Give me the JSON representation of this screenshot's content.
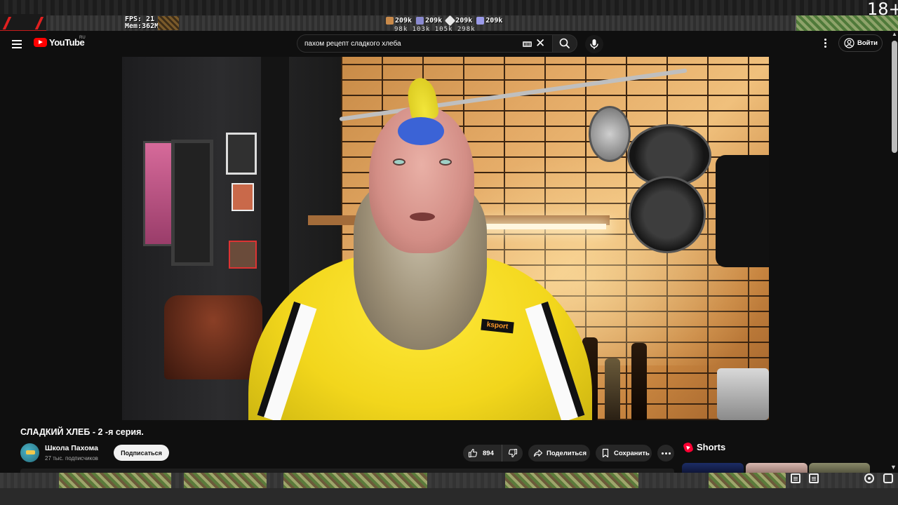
{
  "overlay": {
    "perf_fps": "FPS: 21",
    "perf_mem": "Mem:362Мб",
    "resources": [
      {
        "icon": "wood-icon",
        "color": "#c98a4a",
        "value": "209k"
      },
      {
        "icon": "stone-icon",
        "color": "#8a8ad0",
        "value": "209k"
      },
      {
        "icon": "crystal-icon",
        "color": "#e8e8e8",
        "value": "209k"
      },
      {
        "icon": "ore-icon",
        "color": "#9a9ae8",
        "value": "209k"
      }
    ],
    "resource_subline": "98k  103k  105k  298k",
    "age_rating": "18+"
  },
  "header": {
    "logo_text": "YouTube",
    "logo_region": "RU",
    "search_value": "пахом рецепт сладкого хлеба",
    "clear_glyph": "✕",
    "signin_label": "Войти"
  },
  "video": {
    "title": "СЛАДКИЙ ХЛЕБ - 2 -я серия.",
    "badge_text": "ksport",
    "channel": {
      "name": "Школа Пахома",
      "subscribers": "27 тыс. подписчиков",
      "subscribe_label": "Подписаться"
    },
    "actions": {
      "like_count": "894",
      "share_label": "Поделиться",
      "save_label": "Сохранить"
    }
  },
  "shorts": {
    "title": "Shorts"
  },
  "colors": {
    "background": "#0f0f0f",
    "brand_red": "#ff0000",
    "pill_bg": "#272727",
    "subscribe_bg": "#f1f1f1"
  }
}
